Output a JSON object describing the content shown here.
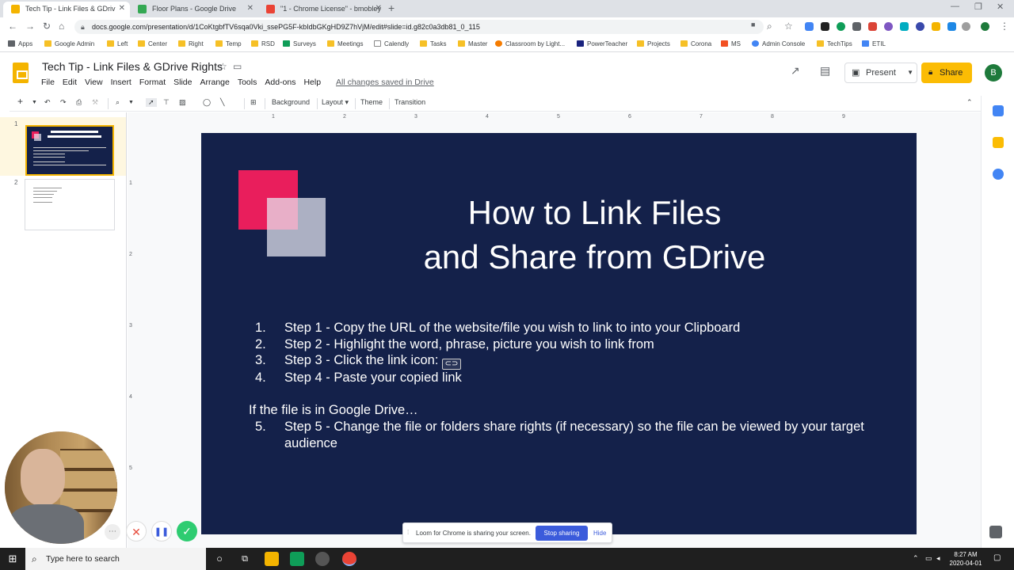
{
  "browser": {
    "tabs": [
      {
        "label": "Tech Tip - Link Files & GDriv",
        "active": true
      },
      {
        "label": "Floor Plans - Google Drive",
        "active": false
      },
      {
        "label": "\"1 - Chrome License\" - bmobley",
        "active": false
      }
    ],
    "url": "docs.google.com/presentation/d/1CoKtgbfTV6sqa0Vki_ssePG5F-kbIdbGKgHD9Z7hVjM/edit#slide=id.g82c0a3db81_0_115",
    "bookmarks": [
      "Apps",
      "Google Admin",
      "Left",
      "Center",
      "Right",
      "Temp",
      "RSD",
      "Surveys",
      "Meetings",
      "Calendly",
      "Tasks",
      "Master",
      "Classroom by Light...",
      "PowerTeacher",
      "Projects",
      "Corona",
      "MS",
      "Admin Console",
      "TechTips",
      "ETIL"
    ]
  },
  "doc": {
    "title": "Tech Tip - Link Files & GDrive Rights",
    "menus": [
      "File",
      "Edit",
      "View",
      "Insert",
      "Format",
      "Slide",
      "Arrange",
      "Tools",
      "Add-ons",
      "Help"
    ],
    "saved_status": "All changes saved in Drive",
    "present_label": "Present",
    "share_label": "Share",
    "avatar_letter": "B"
  },
  "toolbar": {
    "background": "Background",
    "layout": "Layout",
    "theme": "Theme",
    "transition": "Transition"
  },
  "ruler": [
    "1",
    "2",
    "3",
    "4",
    "5",
    "6",
    "7",
    "8",
    "9"
  ],
  "vruler": [
    "1",
    "2",
    "3",
    "4",
    "5"
  ],
  "filmstrip": {
    "slide_numbers": [
      "1",
      "2"
    ]
  },
  "slide": {
    "title_line1": "How to Link Files",
    "title_line2": "and Share from GDrive",
    "steps": [
      {
        "num": "1.",
        "text": "Step 1 - Copy the URL of the website/file you wish to link to into your Clipboard"
      },
      {
        "num": "2.",
        "text": "Step 2 - Highlight the word, phrase, picture you wish to link from"
      },
      {
        "num": "3.",
        "text": "Step 3 - Click the link icon: "
      },
      {
        "num": "4.",
        "text": "Step 4 - Paste your copied link"
      }
    ],
    "gdrive_heading": "If the file is in Google Drive…",
    "step5_num": "5.",
    "step5_text": "Step 5 - Change the file or folders share rights (if necessary) so the file can be viewed by your target audience",
    "colors": {
      "background": "#14214a",
      "accent_pink": "#e91e5c",
      "accent_light": "#e8e8f2"
    }
  },
  "loom": {
    "message": "Loom for Chrome is sharing your screen.",
    "stop_label": "Stop sharing",
    "hide_label": "Hide"
  },
  "taskbar": {
    "search_placeholder": "Type here to search",
    "time": "8:27 AM",
    "date": "2020-04-01"
  }
}
